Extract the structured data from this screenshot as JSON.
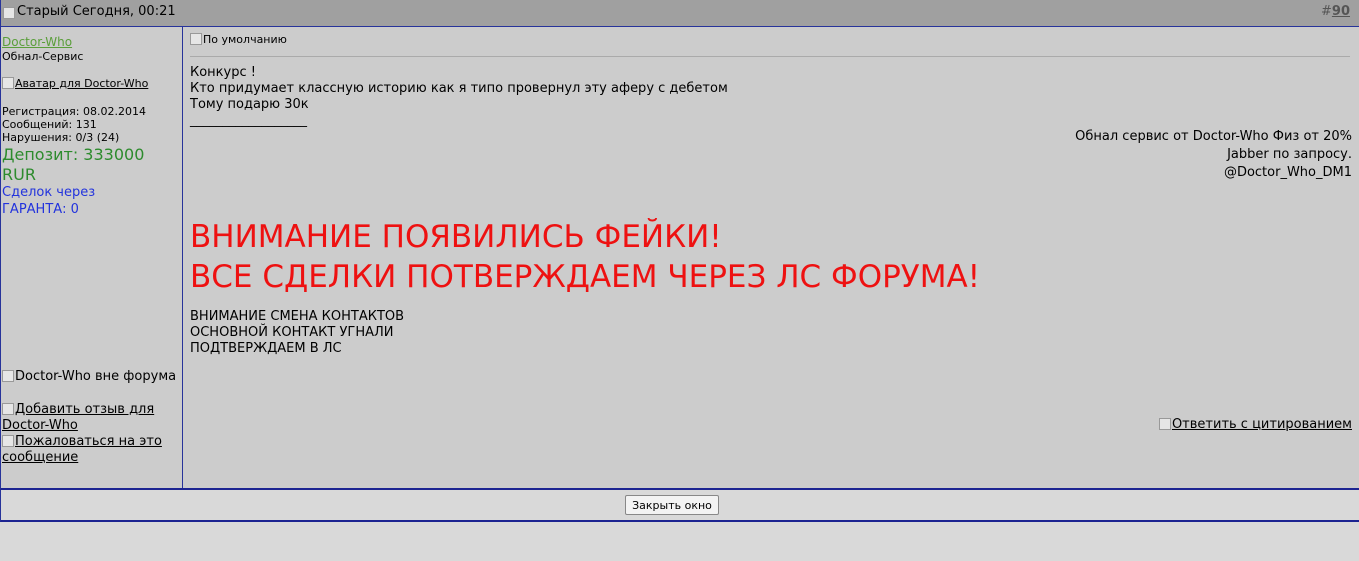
{
  "header": {
    "status_alt": "Старый",
    "date": "Сегодня, 00:21",
    "post_number_prefix": "#",
    "post_number": "90"
  },
  "user": {
    "name": "Doctor-Who",
    "title": "Обнал-Сервис",
    "avatar_alt": "Аватар для Doctor-Who",
    "registration": "Регистрация: 08.02.2014",
    "posts": "Сообщений: 131",
    "violations": "Нарушения: 0/3 (24)",
    "deposit_line1": "Депозит: 333000",
    "deposit_line2": "RUR",
    "deals_line1": "Сделок через",
    "deals_line2": "ГАРАНТА: 0",
    "online_status": "Doctor-Who вне форума",
    "add_review": "Добавить отзыв для Doctor-Who",
    "report": "Пожаловаться на это сообщение"
  },
  "post": {
    "icon_alt": "По умолчанию",
    "message_lines": [
      "Конкурс !",
      "Кто придумает классную историю как я типо провернул эту аферу с дебетом",
      "Тому подарю 30к",
      "__________________"
    ],
    "signature_lines": [
      "Обнал сервис от Doctor-Who Физ от 20%",
      "Jabber по запросу.",
      "@Doctor_Who_DM1"
    ],
    "alert_lines": [
      "ВНИМАНИЕ ПОЯВИЛИСЬ ФЕЙКИ!",
      "ВСЕ СДЕЛКИ ПОТВЕРЖДАЕМ ЧЕРЕЗ ЛС ФОРУМА!"
    ],
    "notice_lines": [
      "ВНИМАНИЕ СМЕНА КОНТАКТОВ",
      "ОСНОВНОЙ КОНТАКТ УГНАЛИ",
      "ПОДТВЕРЖДАЕМ В ЛС"
    ],
    "reply_quote": "Ответить с цитированием"
  },
  "footer": {
    "close_button": "Закрыть окно"
  },
  "colors": {
    "alert": "#ee1111",
    "deposit": "#2d8b2d",
    "deals": "#2233dd",
    "username": "#5a9e3a",
    "border": "#27339a"
  }
}
